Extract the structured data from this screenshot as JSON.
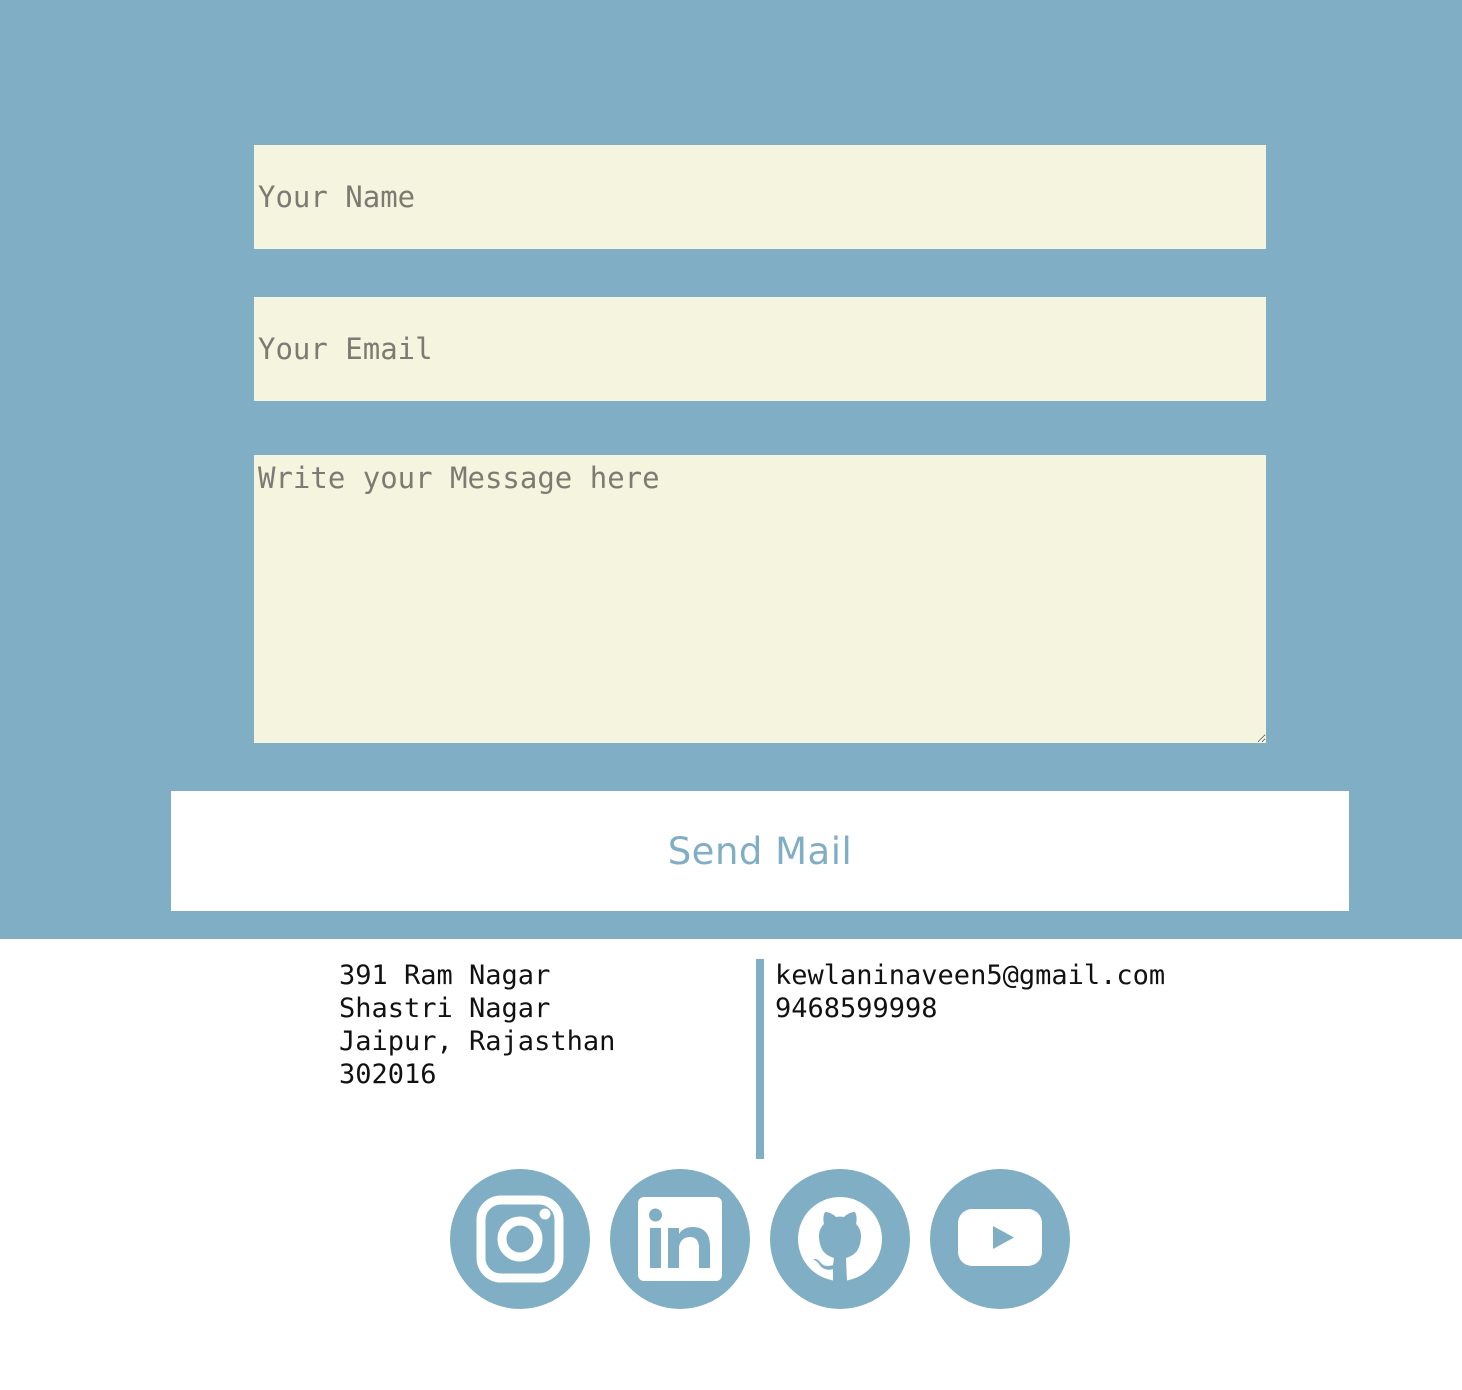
{
  "contact_form": {
    "name_placeholder": "Your Name",
    "email_placeholder": "Your Email",
    "message_placeholder": "Write your Message here",
    "submit_label": "Send Mail"
  },
  "footer": {
    "address_lines": [
      "391 Ram Nagar",
      "Shastri Nagar",
      "Jaipur, Rajasthan",
      "302016"
    ],
    "email": "kewlaninaveen5@gmail.com",
    "phone": "9468599998",
    "social_links": [
      {
        "icon": "instagram-icon"
      },
      {
        "icon": "linkedin-icon"
      },
      {
        "icon": "github-icon"
      },
      {
        "icon": "youtube-icon"
      }
    ]
  },
  "colors": {
    "accent": "#80aec5",
    "field_background": "#f5f4de",
    "button_background": "#ffffff",
    "page_background": "#ffffff"
  }
}
